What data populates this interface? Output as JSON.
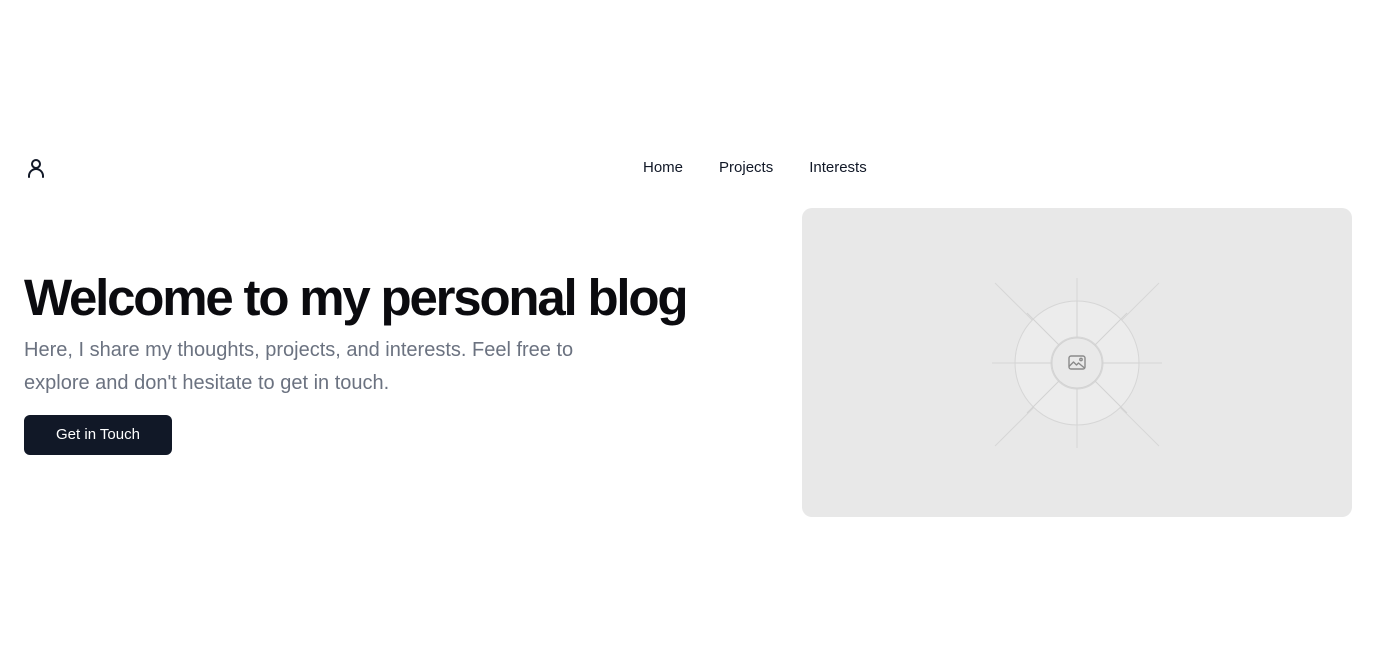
{
  "header": {
    "logo_icon": "user-icon",
    "nav": [
      {
        "label": "Home"
      },
      {
        "label": "Projects"
      },
      {
        "label": "Interests"
      }
    ]
  },
  "hero": {
    "title": "Welcome to my personal blog",
    "subtitle": "Here, I share my thoughts, projects, and interests. Feel free to explore and don't hesitate to get in touch.",
    "cta_label": "Get in Touch",
    "image_icon": "image-icon"
  },
  "colors": {
    "text": "#0b0b0f",
    "muted_text": "#6b7280",
    "button_bg": "#111827",
    "button_text": "#ffffff",
    "placeholder_bg": "#e8e8e8"
  }
}
